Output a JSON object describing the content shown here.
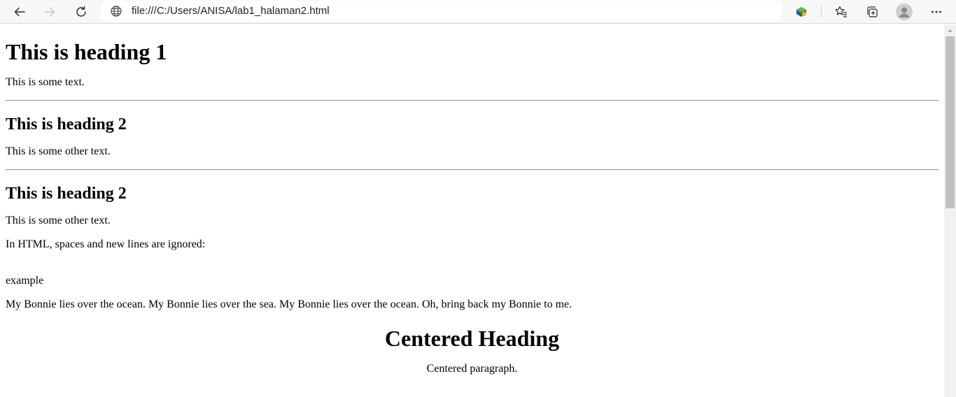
{
  "browser": {
    "address_url": "file:///C:/Users/ANISA/lab1_halaman2.html",
    "icons": [
      "back-icon",
      "forward-icon",
      "refresh-icon",
      "globe-icon",
      "extension-icon",
      "favorites-icon",
      "collections-icon",
      "profile-icon",
      "more-icon"
    ]
  },
  "page": {
    "h1": "This is heading 1",
    "p1": "This is some text.",
    "h2a": "This is heading 2",
    "p2": "This is some other text.",
    "h2b": "This is heading 2",
    "p3": "This is some other text.",
    "p4": "In HTML, spaces and new lines are ignored:",
    "pre": "\nexample",
    "p5": "My Bonnie lies over the ocean. My Bonnie lies over the sea. My Bonnie lies over the ocean. Oh, bring back my Bonnie to me.",
    "centered_heading": "Centered Heading",
    "centered_paragraph": "Centered paragraph."
  }
}
